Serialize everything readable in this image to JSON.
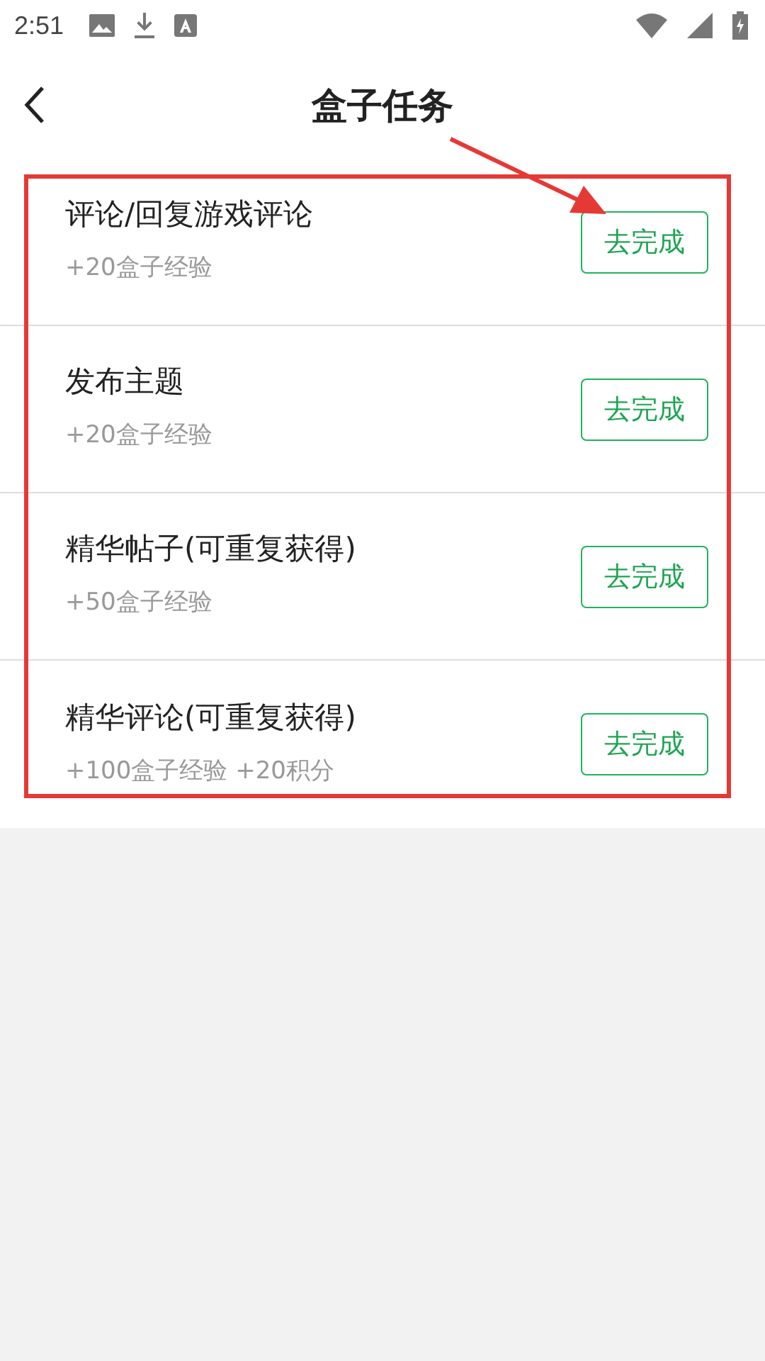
{
  "status_bar": {
    "time": "2:51"
  },
  "header": {
    "title": "盒子任务"
  },
  "tasks": [
    {
      "title": "评论/回复游戏评论",
      "reward": "+20盒子经验",
      "button": "去完成"
    },
    {
      "title": "发布主题",
      "reward": "+20盒子经验",
      "button": "去完成"
    },
    {
      "title": "精华帖子(可重复获得)",
      "reward": "+50盒子经验",
      "button": "去完成"
    },
    {
      "title": "精华评论(可重复获得)",
      "reward": "+100盒子经验 +20积分",
      "button": "去完成"
    }
  ]
}
